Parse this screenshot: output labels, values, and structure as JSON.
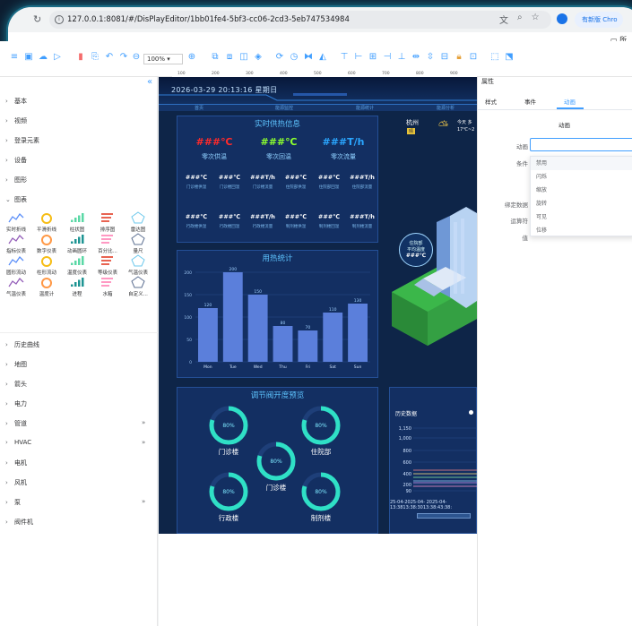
{
  "browser": {
    "url": "127.0.0.1:8081/#/DisPlayEditor/1bb01fe4-5bf3-cc06-2cd3-5eb747534984",
    "new_version": "有新版 Chro",
    "bookmark": "所"
  },
  "toolbar": {
    "zoom": "100%"
  },
  "ruler": {
    "ticks": [
      "100",
      "200",
      "300",
      "400",
      "500",
      "600",
      "700",
      "800",
      "900"
    ]
  },
  "left_panel": {
    "groups_top": [
      "基本",
      "视频",
      "登录元素",
      "设备",
      "图形"
    ],
    "open_group": "图表",
    "items": [
      {
        "label": "实时折线",
        "icon": "realtime-line-icon"
      },
      {
        "label": "平滑折线",
        "icon": "smooth-line-icon"
      },
      {
        "label": "柱状图",
        "icon": "bar-chart-icon"
      },
      {
        "label": "排序图",
        "icon": "sort-chart-icon"
      },
      {
        "label": "雷达图",
        "icon": "radar-chart-icon"
      },
      {
        "label": "指标仪表",
        "icon": "indicator-gauge-icon"
      },
      {
        "label": "数字仪表",
        "icon": "digital-gauge-icon"
      },
      {
        "label": "动画圆环",
        "icon": "animated-ring-icon"
      },
      {
        "label": "百分比...",
        "icon": "percent-icon"
      },
      {
        "label": "量尺",
        "icon": "ruler-icon"
      },
      {
        "label": "圆形流动",
        "icon": "circle-flow-icon"
      },
      {
        "label": "柱形流动",
        "icon": "column-flow-icon"
      },
      {
        "label": "温度仪表",
        "icon": "temperature-gauge-icon"
      },
      {
        "label": "等级仪表",
        "icon": "level-gauge-icon"
      },
      {
        "label": "气温仪表",
        "icon": "air-temp-gauge-icon"
      },
      {
        "label": "气温仪表",
        "icon": "air-temp-gauge2-icon"
      },
      {
        "label": "温度计",
        "icon": "thermometer-icon"
      },
      {
        "label": "进程",
        "icon": "progress-icon"
      },
      {
        "label": "水箱",
        "icon": "water-tank-icon"
      },
      {
        "label": "自定义...",
        "icon": "custom-icon"
      }
    ],
    "groups_bottom": [
      {
        "label": "历史曲线",
        "more": false
      },
      {
        "label": "地图",
        "more": false
      },
      {
        "label": "箭头",
        "more": false
      },
      {
        "label": "电力",
        "more": false
      },
      {
        "label": "管道",
        "more": true
      },
      {
        "label": "HVAC",
        "more": true
      },
      {
        "label": "电机",
        "more": false
      },
      {
        "label": "风机",
        "more": false
      },
      {
        "label": "泵",
        "more": true
      },
      {
        "label": "阀件机",
        "more": false
      }
    ]
  },
  "canvas": {
    "datetime": "2026-03-29  20:13:16  星期日",
    "tabs": [
      "首页",
      "能源监控",
      "能源统计",
      "能源分析"
    ],
    "supply": {
      "title": "实时供热信息",
      "big": [
        {
          "value": "###℃",
          "label": "零次供温",
          "color": "#ff2a2a"
        },
        {
          "value": "###℃",
          "label": "零次回温",
          "color": "#8cff2e"
        },
        {
          "value": "###T/h",
          "label": "零次流量",
          "color": "#2aa6ff"
        }
      ],
      "row1": [
        {
          "v": "###℃",
          "l": "门诊楼供温"
        },
        {
          "v": "###℃",
          "l": "门诊楼回温"
        },
        {
          "v": "###T/h",
          "l": "门诊楼流量"
        },
        {
          "v": "###℃",
          "l": "住院部供温"
        },
        {
          "v": "###℃",
          "l": "住院部回温"
        },
        {
          "v": "###T/h",
          "l": "住院部流量"
        }
      ],
      "row2": [
        {
          "v": "###℃",
          "l": "行政楼供温"
        },
        {
          "v": "###℃",
          "l": "行政楼回温"
        },
        {
          "v": "###T/h",
          "l": "行政楼流量"
        },
        {
          "v": "###℃",
          "l": "制剂楼供温"
        },
        {
          "v": "###℃",
          "l": "制剂楼回温"
        },
        {
          "v": "###T/h",
          "l": "制剂楼流量"
        }
      ]
    },
    "weather": {
      "city": "杭州",
      "badge": "晴",
      "today": "今天 多",
      "temp": "17℃~2"
    },
    "hotspot": {
      "line1": "住院部",
      "line2": "平均温度",
      "value": "###℃"
    },
    "valves": {
      "title": "调节阀开度预览",
      "rings": [
        {
          "value": "80%",
          "label": "门诊楼"
        },
        {
          "value": "80%",
          "label": "住院部"
        },
        {
          "value": "80%",
          "label": "门诊楼"
        },
        {
          "value": "80%",
          "label": "行政楼"
        },
        {
          "value": "80%",
          "label": "制剂楼"
        }
      ]
    },
    "history": {
      "title": "历史数据",
      "yticks": [
        "1,150",
        "1,000",
        "800",
        "600",
        "400",
        "200",
        "90"
      ],
      "xlabel1": "25-04-2025-04-  2025-04-",
      "xlabel2": "13:3813:38:3013:38:43:38:"
    }
  },
  "chart_data": {
    "type": "bar",
    "title": "用热统计",
    "categories": [
      "Mon",
      "Tue",
      "Wed",
      "Thu",
      "Fri",
      "Sat",
      "Sun"
    ],
    "values": [
      120,
      200,
      150,
      80,
      70,
      110,
      130
    ],
    "yticks": [
      "0",
      "50",
      "100",
      "150",
      "200"
    ],
    "ylim": [
      0,
      200
    ],
    "color": "#5b7fdb"
  },
  "right_panel": {
    "title": "属性",
    "tabs": [
      "样式",
      "事件",
      "动画"
    ],
    "active_tab": "动画",
    "section": "动画",
    "labels": [
      "动画",
      "条件",
      "绑定数据",
      "运算符",
      "值"
    ],
    "options": [
      "禁用",
      "闪烁",
      "缩放",
      "旋转",
      "可见",
      "位移"
    ]
  }
}
